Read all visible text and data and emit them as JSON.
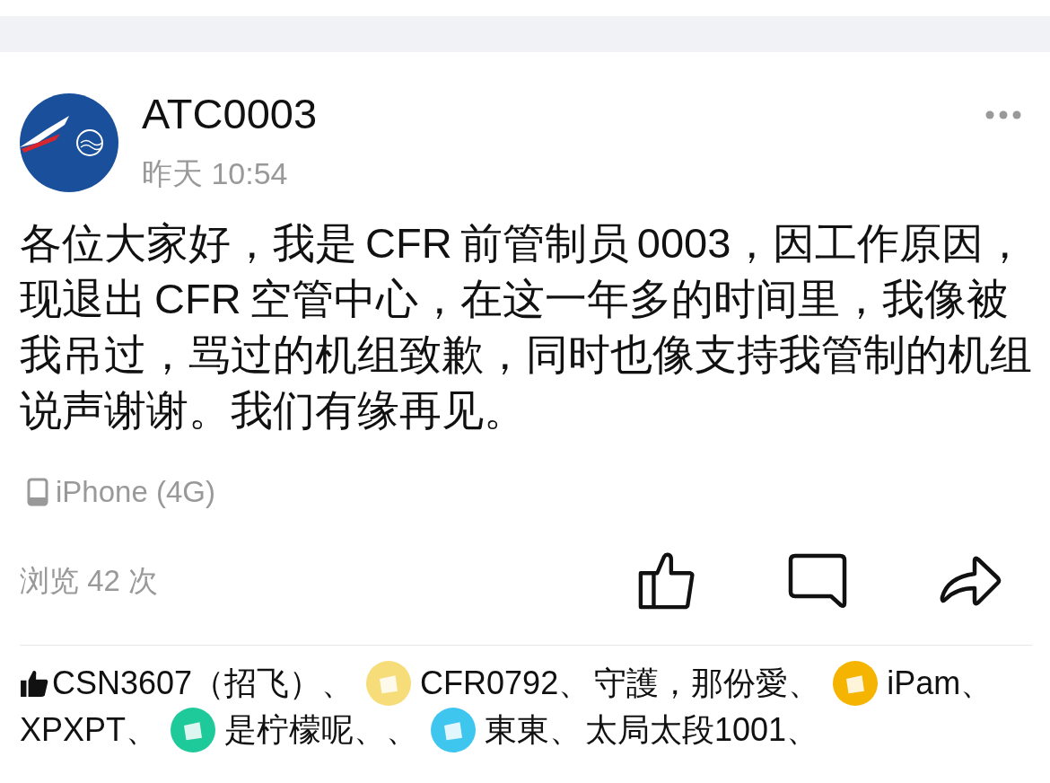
{
  "post": {
    "author": "ATC0003",
    "time": "昨天 10:54",
    "body": "各位大家好，我是 CFR 前管制员 0003，因工作原因，现退出 CFR 空管中心，在这一年多的时间里，我像被我吊过，骂过的机组致歉，同时也像支持我管制的机组说声谢谢。我们有缘再见。",
    "device": "iPhone (4G)",
    "views": "浏览 42 次"
  },
  "likes": [
    {
      "name": "CSN3607（招飞）、"
    },
    {
      "name": "CFR0792、",
      "color": "#f7dc7a"
    },
    {
      "name": "守護，那份愛、"
    },
    {
      "name": "iPam、",
      "color": "#f5b400"
    },
    {
      "name": "XPXPT、"
    },
    {
      "name": "是柠檬呢、、",
      "color": "#1ec99a"
    },
    {
      "name": "東東、",
      "color": "#3fc6ef"
    },
    {
      "name": "太局太段1001、"
    }
  ]
}
